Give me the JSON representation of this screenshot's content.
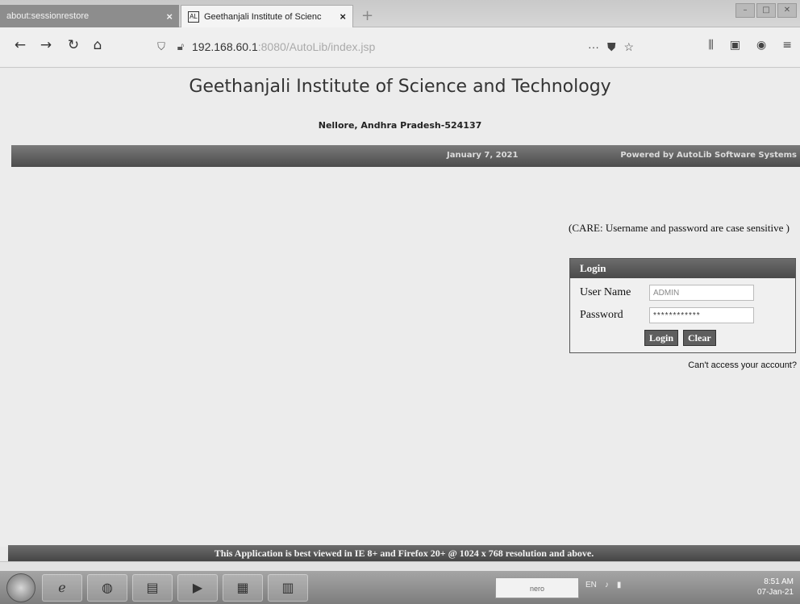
{
  "browser": {
    "tabs": [
      {
        "title": "about:sessionrestore",
        "close": "×"
      },
      {
        "title": "Geethanjali Institute of Scienc",
        "close": "×"
      }
    ],
    "new_tab": "+",
    "url_host": "192.168.60.1",
    "url_rest": ":8080/AutoLib/index.jsp",
    "url_more": "···"
  },
  "page": {
    "title": "Geethanjali Institute of Science and Technology",
    "subtitle": "Nellore, Andhra Pradesh-524137",
    "banner": {
      "date": "January 7, 2021",
      "powered_by": "Powered by AutoLib Software Systems"
    },
    "care_note": "(CARE: Username and password are case sensitive )",
    "login": {
      "heading": "Login",
      "username_label": "User Name",
      "username_value": "ADMIN",
      "password_label": "Password",
      "password_value": "************",
      "login_button": "Login",
      "clear_button": "Clear"
    },
    "cant_access": "Can't access your account?",
    "footer": "This Application is best viewed in IE 8+ and Firefox 20+ @ 1024 x 768 resolution and above."
  },
  "taskbar": {
    "nero_label": "nero",
    "tray_lang": "EN",
    "time": "8:51 AM",
    "date": "07-Jan-21"
  }
}
